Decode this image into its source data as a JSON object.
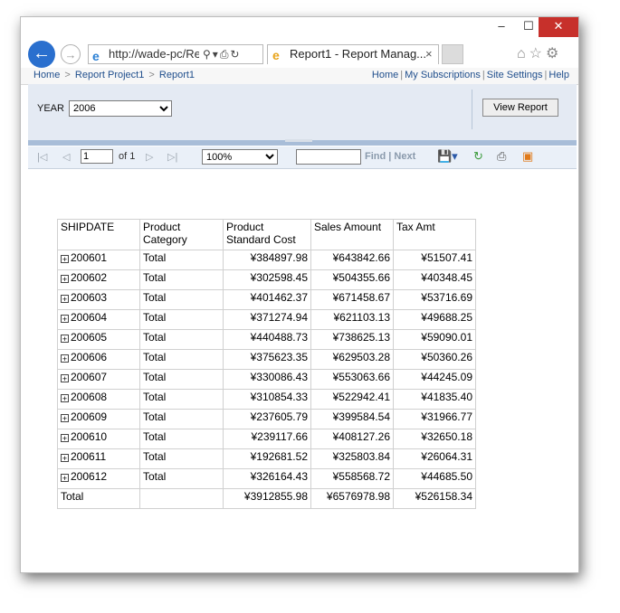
{
  "browser": {
    "url": "http://wade-pc/Re",
    "tab_title": "Report1 - Report Manag...",
    "tab_close": "×",
    "window_buttons": {
      "minimize": "–",
      "maximize": "☐",
      "close": "✕"
    }
  },
  "breadcrumb": {
    "items": [
      "Home",
      "Report Project1",
      "Report1"
    ],
    "separator": ">"
  },
  "top_links": [
    "Home",
    "My Subscriptions",
    "Site Settings",
    "Help"
  ],
  "params": {
    "year_label": "YEAR",
    "year_value": "2006",
    "view_report": "View Report"
  },
  "toolbar": {
    "page": "1",
    "of": "of 1",
    "zoom": "100%",
    "find": "Find",
    "sep": "|",
    "next": "Next"
  },
  "table": {
    "headers": [
      "SHIPDATE",
      "Product Category",
      "Product Standard Cost",
      "Sales Amount",
      "Tax Amt"
    ],
    "rows": [
      {
        "ship": "200601",
        "cat": "Total",
        "cost": "¥384897.98",
        "sales": "¥643842.66",
        "tax": "¥51507.41"
      },
      {
        "ship": "200602",
        "cat": "Total",
        "cost": "¥302598.45",
        "sales": "¥504355.66",
        "tax": "¥40348.45"
      },
      {
        "ship": "200603",
        "cat": "Total",
        "cost": "¥401462.37",
        "sales": "¥671458.67",
        "tax": "¥53716.69"
      },
      {
        "ship": "200604",
        "cat": "Total",
        "cost": "¥371274.94",
        "sales": "¥621103.13",
        "tax": "¥49688.25"
      },
      {
        "ship": "200605",
        "cat": "Total",
        "cost": "¥440488.73",
        "sales": "¥738625.13",
        "tax": "¥59090.01"
      },
      {
        "ship": "200606",
        "cat": "Total",
        "cost": "¥375623.35",
        "sales": "¥629503.28",
        "tax": "¥50360.26"
      },
      {
        "ship": "200607",
        "cat": "Total",
        "cost": "¥330086.43",
        "sales": "¥553063.66",
        "tax": "¥44245.09"
      },
      {
        "ship": "200608",
        "cat": "Total",
        "cost": "¥310854.33",
        "sales": "¥522942.41",
        "tax": "¥41835.40"
      },
      {
        "ship": "200609",
        "cat": "Total",
        "cost": "¥237605.79",
        "sales": "¥399584.54",
        "tax": "¥31966.77"
      },
      {
        "ship": "200610",
        "cat": "Total",
        "cost": "¥239117.66",
        "sales": "¥408127.26",
        "tax": "¥32650.18"
      },
      {
        "ship": "200611",
        "cat": "Total",
        "cost": "¥192681.52",
        "sales": "¥325803.84",
        "tax": "¥26064.31"
      },
      {
        "ship": "200612",
        "cat": "Total",
        "cost": "¥326164.43",
        "sales": "¥558568.72",
        "tax": "¥44685.50"
      }
    ],
    "total": {
      "label": "Total",
      "cost": "¥3912855.98",
      "sales": "¥6576978.98",
      "tax": "¥526158.34"
    }
  }
}
